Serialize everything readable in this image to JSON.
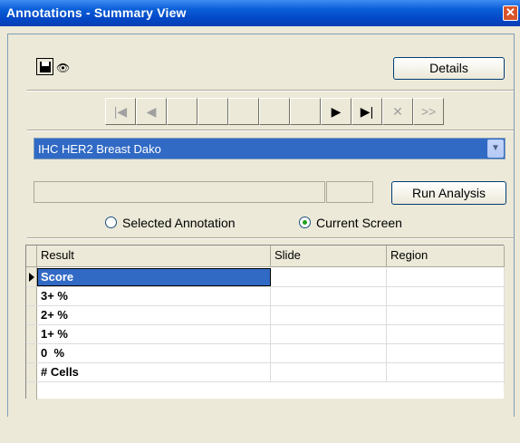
{
  "window": {
    "title": "Annotations - Summary View",
    "close_glyph": "✕"
  },
  "toolbar": {
    "save_icon": "save-icon",
    "view_icon": "eye-icon",
    "view_glyph": "👁",
    "details_label": "Details"
  },
  "navigation": {
    "buttons": [
      {
        "name": "first",
        "glyph": "|◀",
        "enabled": false
      },
      {
        "name": "previous",
        "glyph": "◀",
        "enabled": false
      },
      {
        "name": "blank1",
        "glyph": "",
        "enabled": false
      },
      {
        "name": "blank2",
        "glyph": "",
        "enabled": false
      },
      {
        "name": "blank3",
        "glyph": "",
        "enabled": false
      },
      {
        "name": "blank4",
        "glyph": "",
        "enabled": false
      },
      {
        "name": "blank5",
        "glyph": "",
        "enabled": false
      },
      {
        "name": "next",
        "glyph": "▶",
        "enabled": true
      },
      {
        "name": "last",
        "glyph": "▶|",
        "enabled": true
      },
      {
        "name": "delete",
        "glyph": "✕",
        "enabled": false
      },
      {
        "name": "skip",
        "glyph": ">>",
        "enabled": false
      }
    ]
  },
  "analysis": {
    "selected_algorithm": "IHC HER2 Breast Dako",
    "dropdown_arrow": "▼",
    "run_label": "Run Analysis"
  },
  "scope": {
    "option_selected": "Selected Annotation",
    "option_current": "Current Screen",
    "current_checked": true
  },
  "results": {
    "columns": [
      "Result",
      "Slide",
      "Region"
    ],
    "rows": [
      {
        "result": "Score",
        "slide": "",
        "region": ""
      },
      {
        "result": "3+ %",
        "slide": "",
        "region": ""
      },
      {
        "result": "2+ %",
        "slide": "",
        "region": ""
      },
      {
        "result": "1+ %",
        "slide": "",
        "region": ""
      },
      {
        "result": "0  %",
        "slide": "",
        "region": ""
      },
      {
        "result": "# Cells",
        "slide": "",
        "region": ""
      }
    ]
  }
}
